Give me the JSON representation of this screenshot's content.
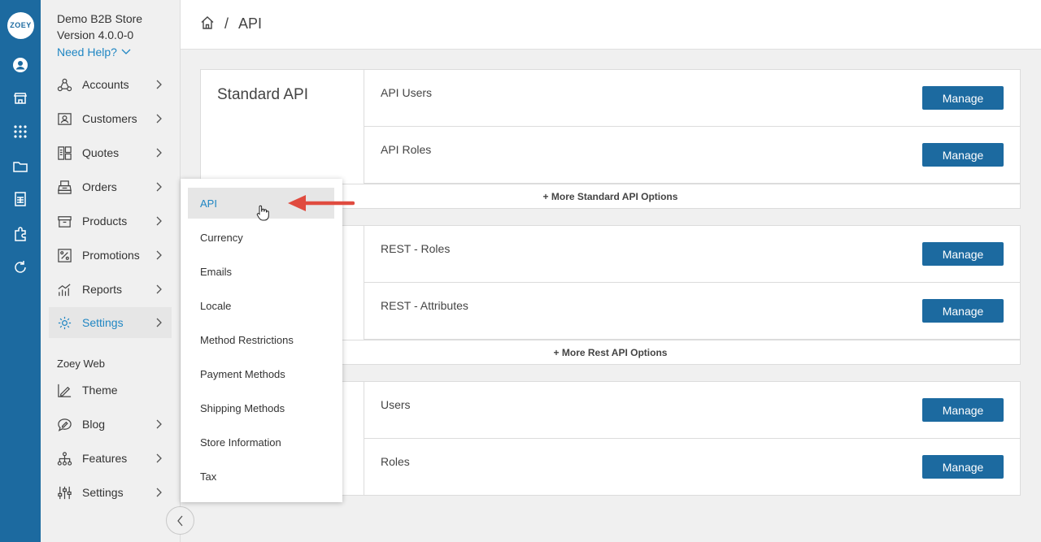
{
  "rail": {
    "logo_text": "ZOEY",
    "icons": [
      "user-circle-icon",
      "storefront-icon",
      "apps-grid-icon",
      "folder-icon",
      "spreadsheet-icon",
      "puzzle-icon",
      "refresh-icon"
    ]
  },
  "store": {
    "name": "Demo B2B Store",
    "version": "Version 4.0.0-0",
    "help_label": "Need Help?"
  },
  "nav": {
    "items": [
      {
        "label": "Accounts",
        "icon": "accounts-icon"
      },
      {
        "label": "Customers",
        "icon": "customers-icon"
      },
      {
        "label": "Quotes",
        "icon": "quotes-icon"
      },
      {
        "label": "Orders",
        "icon": "orders-icon"
      },
      {
        "label": "Products",
        "icon": "products-icon"
      },
      {
        "label": "Promotions",
        "icon": "promotions-icon"
      },
      {
        "label": "Reports",
        "icon": "reports-icon"
      },
      {
        "label": "Settings",
        "icon": "gear-icon",
        "active": true
      }
    ],
    "section_label": "Zoey Web",
    "web_items": [
      {
        "label": "Theme",
        "icon": "theme-icon"
      },
      {
        "label": "Blog",
        "icon": "blog-icon"
      },
      {
        "label": "Features",
        "icon": "features-icon"
      },
      {
        "label": "Settings",
        "icon": "sliders-icon"
      }
    ]
  },
  "breadcrumb": {
    "separator": "/",
    "page": "API"
  },
  "cards": [
    {
      "title": "Standard API",
      "rows": [
        {
          "label": "API Users",
          "button": "Manage"
        },
        {
          "label": "API Roles",
          "button": "Manage"
        }
      ],
      "more": "+ More Standard API Options"
    },
    {
      "title": "",
      "rows": [
        {
          "label": "REST - Roles",
          "button": "Manage"
        },
        {
          "label": "REST - Attributes",
          "button": "Manage"
        }
      ],
      "more": "+ More Rest API Options"
    },
    {
      "title": "",
      "rows": [
        {
          "label": "Users",
          "button": "Manage"
        },
        {
          "label": "Roles",
          "button": "Manage"
        }
      ]
    }
  ],
  "dropdown": {
    "items": [
      "API",
      "Currency",
      "Emails",
      "Locale",
      "Method Restrictions",
      "Payment Methods",
      "Shipping Methods",
      "Store Information",
      "Tax"
    ],
    "selected": "API"
  },
  "colors": {
    "brand": "#1c6aa0",
    "link": "#1f86c3",
    "arrow": "#e04b3f"
  }
}
